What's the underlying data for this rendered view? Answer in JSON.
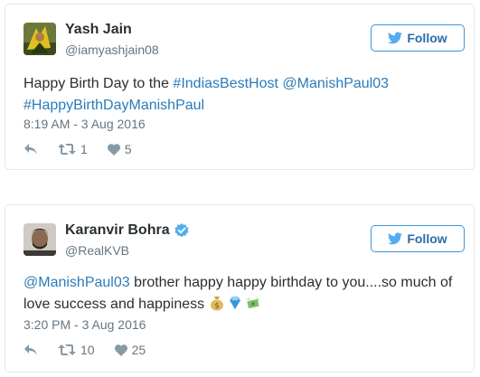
{
  "tweets": [
    {
      "name": "Yash Jain",
      "handle": "@iamyashjain08",
      "follow_label": "Follow",
      "text_plain_1": "Happy Birth Day to the ",
      "link_1": "#IndiasBestHost",
      "text_plain_2": " ",
      "link_2": "@ManishPaul03",
      "link_3": "#HappyBirthDayManishPaul",
      "timestamp": "8:19 AM - 3 Aug 2016",
      "retweets": "1",
      "likes": "5"
    },
    {
      "name": "Karanvir Bohra",
      "handle": "@RealKVB",
      "verified": true,
      "follow_label": "Follow",
      "link_1": "@ManishPaul03",
      "text_plain_1": " brother happy happy birthday to you....so much of",
      "text_plain_2": "love success and happiness ",
      "emojis": [
        "money-bag-emoji",
        "gem-emoji",
        "money-with-wings-emoji"
      ],
      "timestamp": "3:20 PM - 3 Aug 2016",
      "retweets": "10",
      "likes": "25"
    }
  ],
  "colors": {
    "link": "#2b7bb9",
    "follow_border": "#3b94d9",
    "muted": "#66757f",
    "card_border": "#e1e8ed"
  }
}
